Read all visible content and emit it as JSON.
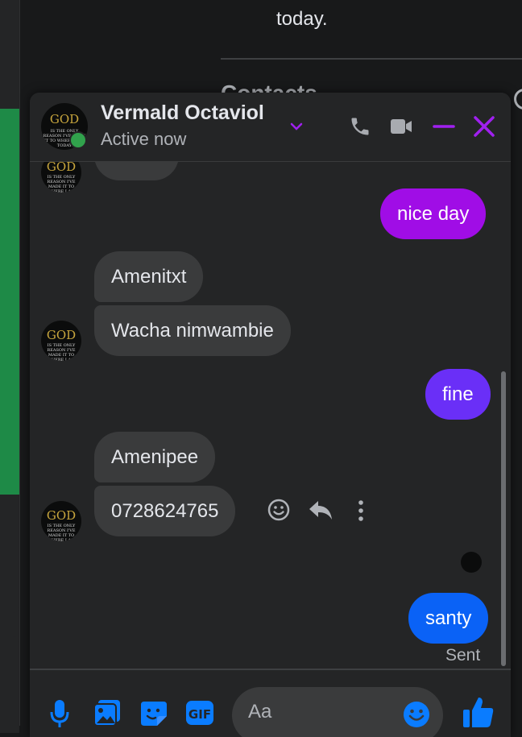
{
  "background": {
    "top_text": "today.",
    "section_title": "Contacts"
  },
  "chat": {
    "contact_name": "Vermald Octaviol",
    "status": "Active now",
    "avatar_title": "GOD",
    "avatar_caption": "IS THE ONLY REASON I'VE MADE IT TO WHERE I AM TODAY",
    "icons": [
      "chevron-down-icon",
      "phone-icon",
      "video-icon",
      "minimize-icon",
      "close-icon"
    ],
    "colors": {
      "accent": "#a020f0",
      "outgoing_purple": "#a00de6",
      "outgoing_violet": "#6a2ff7",
      "outgoing_blue": "#0a62f6",
      "presence": "#31a24c"
    }
  },
  "messages": [
    {
      "from": "me",
      "text": "nice day"
    },
    {
      "from": "them",
      "text": "Amenitxt"
    },
    {
      "from": "them",
      "text": "Wacha nimwambie"
    },
    {
      "from": "me",
      "text": "fine"
    },
    {
      "from": "them",
      "text": "Amenipee"
    },
    {
      "from": "them",
      "text": "0728624765"
    },
    {
      "from": "me",
      "text": "santy"
    }
  ],
  "message_actions": [
    "react-icon",
    "reply-icon",
    "more-icon"
  ],
  "delivery_status": "Sent",
  "composer": {
    "placeholder": "Aa",
    "icons": [
      "microphone-icon",
      "photo-icon",
      "sticker-icon",
      "gif-icon",
      "emoji-icon",
      "like-icon"
    ]
  }
}
